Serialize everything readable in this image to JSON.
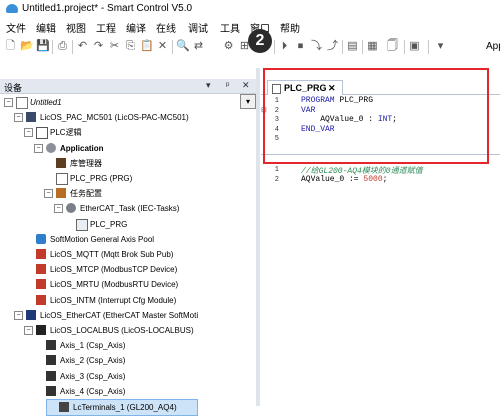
{
  "window": {
    "title": "Untitled1.project* - Smart Control V5.0"
  },
  "menu": [
    "文件",
    "编辑",
    "视图",
    "工程",
    "编译",
    "在线",
    "调试",
    "工具",
    "窗口",
    "帮助"
  ],
  "toolbar": {
    "app_label": "App",
    "badge": "2"
  },
  "device_panel": {
    "title": "设备",
    "controls": [
      "▾",
      "ᵖ",
      "✕"
    ],
    "tree": [
      {
        "label": "Untitled1",
        "indent": 0,
        "expand": "−",
        "icon": "project",
        "italic": true
      },
      {
        "label": "LicOS_PAC_MC501 (LicOS-PAC-MC501)",
        "indent": 1,
        "expand": "−",
        "icon": "device"
      },
      {
        "label": "PLC逻辑",
        "indent": 2,
        "expand": "−",
        "icon": "plc"
      },
      {
        "label": "Application",
        "indent": 3,
        "expand": "−",
        "icon": "gear",
        "bold": true
      },
      {
        "label": "库管理器",
        "indent": 4,
        "icon": "library"
      },
      {
        "label": "PLC_PRG (PRG)",
        "indent": 4,
        "icon": "doc"
      },
      {
        "label": "任务配置",
        "indent": 4,
        "expand": "−",
        "icon": "task"
      },
      {
        "label": "EtherCAT_Task (IEC-Tasks)",
        "indent": 5,
        "expand": "−",
        "icon": "cog"
      },
      {
        "label": "PLC_PRG",
        "indent": 6,
        "icon": "prg"
      },
      {
        "label": "SoftMotion General Axis Pool",
        "indent": 2,
        "icon": "axis"
      },
      {
        "label": "LicOS_MQTT (Mqtt Brok Sub Pub)",
        "indent": 2,
        "icon": "module"
      },
      {
        "label": "LicOS_MTCP (ModbusTCP Device)",
        "indent": 2,
        "icon": "module"
      },
      {
        "label": "LicOS_MRTU (ModbusRTU Device)",
        "indent": 2,
        "icon": "module"
      },
      {
        "label": "LicOS_INTM (Interrupt Cfg Module)",
        "indent": 2,
        "icon": "module"
      },
      {
        "label": "LicOS_EtherCAT (EtherCAT Master SoftMoti",
        "indent": 1,
        "expand": "−",
        "icon": "ecat"
      },
      {
        "label": "LicOS_LOCALBUS (LicOS-LOCALBUS)",
        "indent": 2,
        "expand": "−",
        "icon": "bus"
      },
      {
        "label": "Axis_1 (Csp_Axis)",
        "indent": 3,
        "icon": "axisitem"
      },
      {
        "label": "Axis_2 (Csp_Axis)",
        "indent": 3,
        "icon": "axisitem"
      },
      {
        "label": "Axis_3 (Csp_Axis)",
        "indent": 3,
        "icon": "axisitem"
      },
      {
        "label": "Axis_4 (Csp_Axis)",
        "indent": 3,
        "icon": "axisitem"
      },
      {
        "label": "LcTerminals_1 (GL200_AQ4)",
        "indent": 3,
        "icon": "io",
        "selected": true
      }
    ]
  },
  "editor": {
    "tab_label": "PLC_PRG",
    "tab_close": "✕",
    "declarations": [
      {
        "num": "1",
        "text": "PROGRAM PLC_PRG",
        "kind": "kw"
      },
      {
        "num": "2",
        "text": "VAR",
        "kind": "kw"
      },
      {
        "num": "3",
        "text": "    AQValue_0 : INT;",
        "kind": "decl"
      },
      {
        "num": "4",
        "text": "END_VAR",
        "kind": "kw"
      },
      {
        "num": "5",
        "text": "",
        "kind": "plain"
      }
    ],
    "implementation": [
      {
        "num": "1",
        "text": "//给GL200-AQ4模块的0通道赋值",
        "kind": "cm"
      },
      {
        "num": "2",
        "text": "AQValue_0 := 5000;",
        "kind": "assign"
      }
    ]
  }
}
